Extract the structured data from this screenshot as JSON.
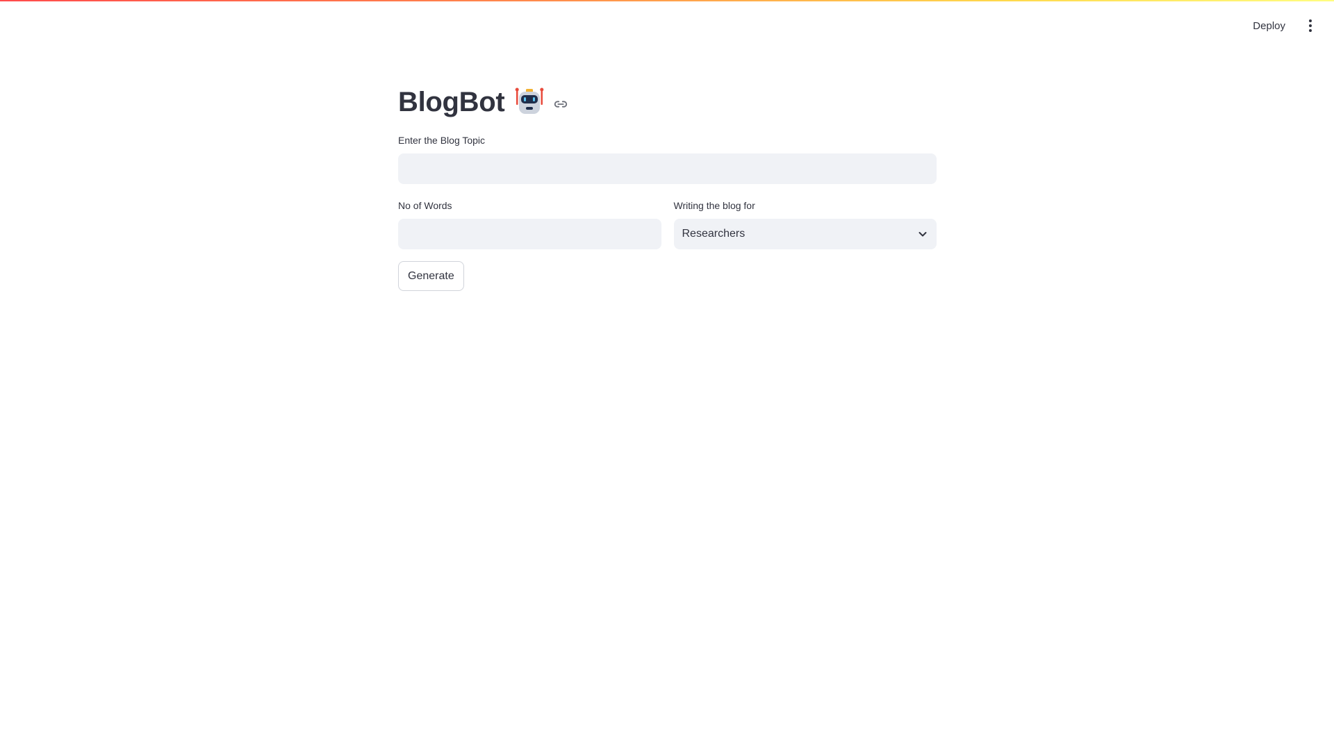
{
  "header": {
    "deploy_label": "Deploy",
    "menu_icon": "kebab-menu-icon"
  },
  "main": {
    "title": "BlogBot",
    "title_emoji_icon": "robot-icon",
    "anchor_icon": "link-icon",
    "topic": {
      "label": "Enter the Blog Topic",
      "value": ""
    },
    "words": {
      "label": "No of Words",
      "value": ""
    },
    "audience": {
      "label": "Writing the blog for",
      "selected": "Researchers"
    },
    "generate_label": "Generate"
  },
  "colors": {
    "accent": "#ff4b4b",
    "text": "#31333f",
    "input_bg": "#f0f2f6"
  }
}
